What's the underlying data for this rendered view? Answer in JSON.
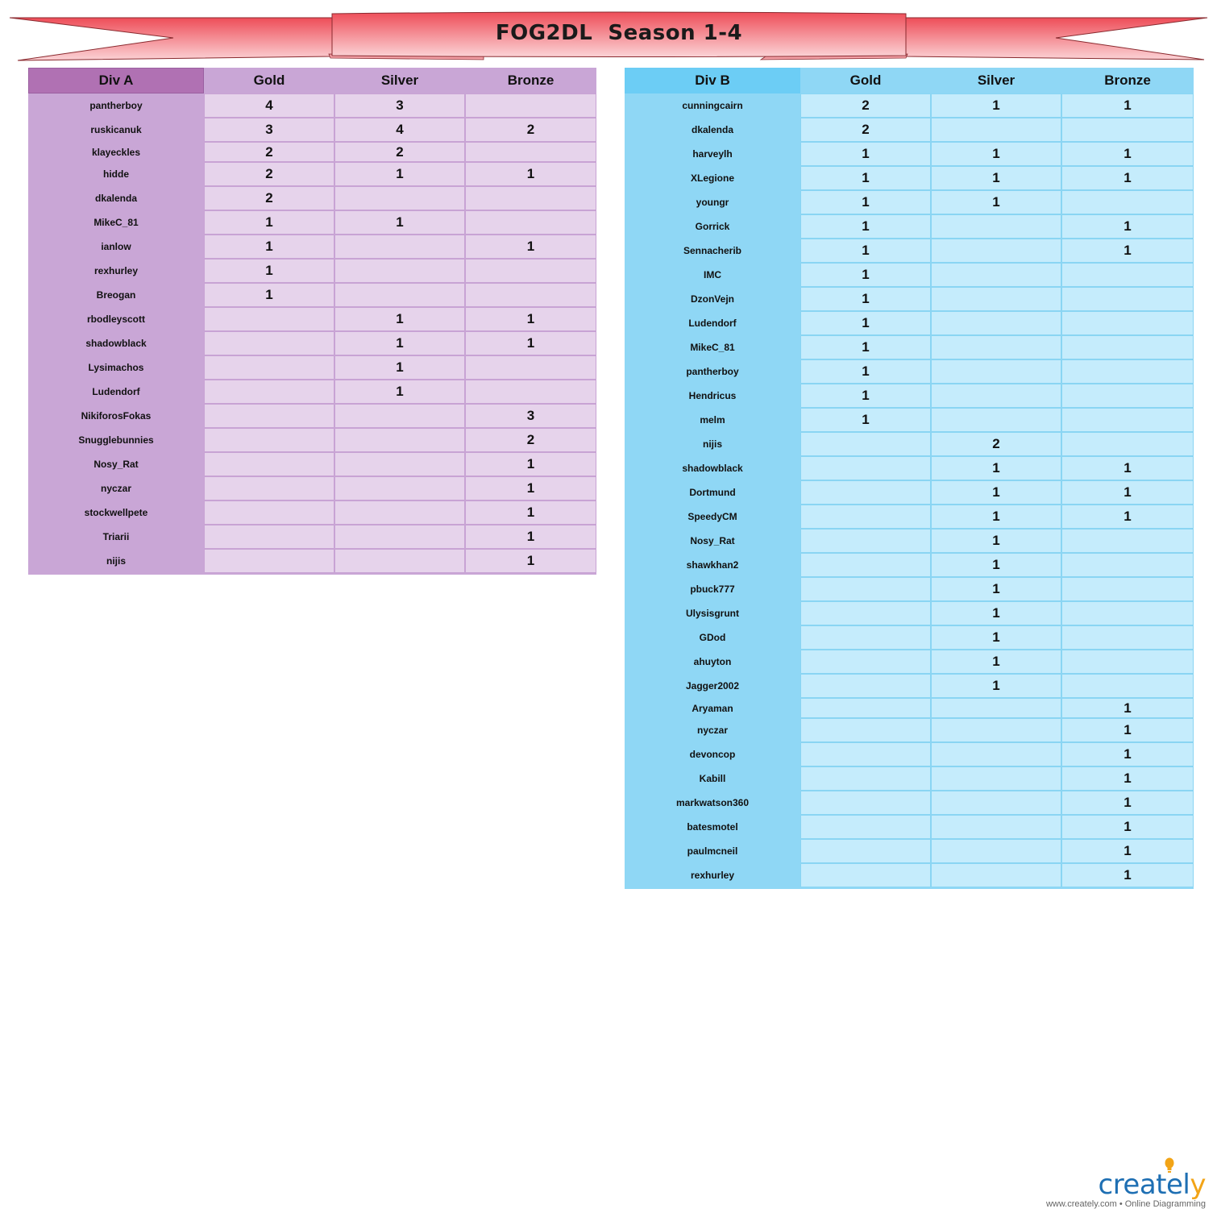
{
  "title": "FOG2DL  Season 1-4",
  "tables": {
    "div_a": {
      "headers": [
        "Div A",
        "Gold",
        "Silver",
        "Bronze"
      ],
      "rows": [
        [
          "pantherboy",
          "4",
          "3",
          ""
        ],
        [
          "ruskicanuk",
          "3",
          "4",
          "2"
        ],
        [
          "klayeckles",
          "2",
          "2",
          ""
        ],
        [
          "hidde",
          "2",
          "1",
          "1"
        ],
        [
          "dkalenda",
          "2",
          "",
          ""
        ],
        [
          "MikeC_81",
          "1",
          "1",
          ""
        ],
        [
          "ianlow",
          "1",
          "",
          "1"
        ],
        [
          "rexhurley",
          "1",
          "",
          ""
        ],
        [
          "Breogan",
          "1",
          "",
          ""
        ],
        [
          "rbodleyscott",
          "",
          "1",
          "1"
        ],
        [
          "shadowblack",
          "",
          "1",
          "1"
        ],
        [
          "Lysimachos",
          "",
          "1",
          ""
        ],
        [
          "Ludendorf",
          "",
          "1",
          ""
        ],
        [
          "NikiforosFokas",
          "",
          "",
          "3"
        ],
        [
          "Snugglebunnies",
          "",
          "",
          "2"
        ],
        [
          "Nosy_Rat",
          "",
          "",
          "1"
        ],
        [
          "nyczar",
          "",
          "",
          "1"
        ],
        [
          "stockwellpete",
          "",
          "",
          "1"
        ],
        [
          "Triarii",
          "",
          "",
          "1"
        ],
        [
          "nijis",
          "",
          "",
          "1"
        ]
      ]
    },
    "div_b": {
      "headers": [
        "Div B",
        "Gold",
        "Silver",
        "Bronze"
      ],
      "rows": [
        [
          "cunningcairn",
          "2",
          "1",
          "1"
        ],
        [
          "dkalenda",
          "2",
          "",
          ""
        ],
        [
          "harveylh",
          "1",
          "1",
          "1"
        ],
        [
          "XLegione",
          "1",
          "1",
          "1"
        ],
        [
          "youngr",
          "1",
          "1",
          ""
        ],
        [
          "Gorrick",
          "1",
          "",
          "1"
        ],
        [
          "Sennacherib",
          "1",
          "",
          "1"
        ],
        [
          "IMC",
          "1",
          "",
          ""
        ],
        [
          "DzonVejn",
          "1",
          "",
          ""
        ],
        [
          "Ludendorf",
          "1",
          "",
          ""
        ],
        [
          "MikeC_81",
          "1",
          "",
          ""
        ],
        [
          "pantherboy",
          "1",
          "",
          ""
        ],
        [
          "Hendricus",
          "1",
          "",
          ""
        ],
        [
          "melm",
          "1",
          "",
          ""
        ],
        [
          "nijis",
          "",
          "2",
          ""
        ],
        [
          "shadowblack",
          "",
          "1",
          "1"
        ],
        [
          "Dortmund",
          "",
          "1",
          "1"
        ],
        [
          "SpeedyCM",
          "",
          "1",
          "1"
        ],
        [
          "Nosy_Rat",
          "",
          "1",
          ""
        ],
        [
          "shawkhan2",
          "",
          "1",
          ""
        ],
        [
          "pbuck777",
          "",
          "1",
          ""
        ],
        [
          "Ulysisgrunt",
          "",
          "1",
          ""
        ],
        [
          "GDod",
          "",
          "1",
          ""
        ],
        [
          "ahuyton",
          "",
          "1",
          ""
        ],
        [
          "Jagger2002",
          "",
          "1",
          ""
        ],
        [
          "Aryaman",
          "",
          "",
          "1"
        ],
        [
          "nyczar",
          "",
          "",
          "1"
        ],
        [
          "devoncop",
          "",
          "",
          "1"
        ],
        [
          "Kabill",
          "",
          "",
          "1"
        ],
        [
          "markwatson360",
          "",
          "",
          "1"
        ],
        [
          "batesmotel",
          "",
          "",
          "1"
        ],
        [
          "paulmcneil",
          "",
          "",
          "1"
        ],
        [
          "rexhurley",
          "",
          "",
          "1"
        ]
      ]
    }
  },
  "logo": {
    "word_main": "createl",
    "word_accent": "y",
    "tagline": "www.creately.com • Online Diagramming"
  },
  "colors": {
    "banner": "#f0545e",
    "div_a_accent": "#b071b3",
    "div_b_accent": "#6ccdf5"
  }
}
